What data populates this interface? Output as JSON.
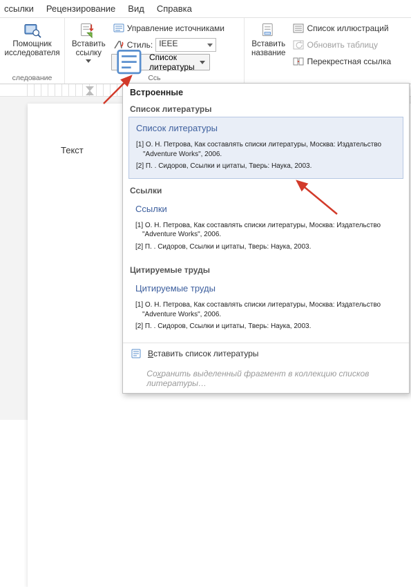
{
  "tabs": {
    "links": "ссылки",
    "review": "Рецензирование",
    "view": "Вид",
    "help": "Справка"
  },
  "ribbon": {
    "researcher": {
      "label": "Помощник\nисследователя",
      "group": "следование"
    },
    "citations": {
      "insert": "Вставить\nссылку",
      "group": "Ссь",
      "manage_sources": "Управление источниками",
      "style_label": "Стиль:",
      "style_value": "IEEE",
      "bibliography": "Список литературы"
    },
    "captions": {
      "insert_caption": "Вставить\nназвание",
      "figures_list": "Список иллюстраций",
      "update_table": "Обновить таблицу",
      "cross_ref": "Перекрестная ссылка"
    }
  },
  "page": {
    "text": "Текст"
  },
  "dropdown": {
    "builtin_head": "Встроенные",
    "sections": [
      {
        "name": "Список литературы",
        "title": "Список литературы",
        "selected": true,
        "entries": [
          "[1] О. Н. Петрова, Как составлять списки литературы, Москва: Издательство \"Adventure Works\", 2006.",
          "[2] П. . Сидоров, Ссылки и цитаты, Тверь: Наука, 2003."
        ]
      },
      {
        "name": "Ссылки",
        "title": "Ссылки",
        "selected": false,
        "entries": [
          "[1] О. Н. Петрова, Как составлять списки литературы, Москва: Издательство \"Adventure Works\", 2006.",
          "[2] П. . Сидоров, Ссылки и цитаты, Тверь: Наука, 2003."
        ]
      },
      {
        "name": "Цитируемые труды",
        "title": "Цитируемые труды",
        "selected": false,
        "entries": [
          "[1] О. Н. Петрова, Как составлять списки литературы, Москва: Издательство \"Adventure Works\", 2006.",
          "[2] П. . Сидоров, Ссылки и цитаты, Тверь: Наука, 2003."
        ]
      }
    ],
    "insert_biblio_prefix": "В",
    "insert_biblio_rest": "ставить список литературы",
    "save_prefix": "Со",
    "save_underline": "х",
    "save_rest": "ранить выделенный фрагмент в коллекцию списков литературы…"
  },
  "colors": {
    "accent": "#3d5f9e",
    "arrow": "#d23a2a"
  }
}
